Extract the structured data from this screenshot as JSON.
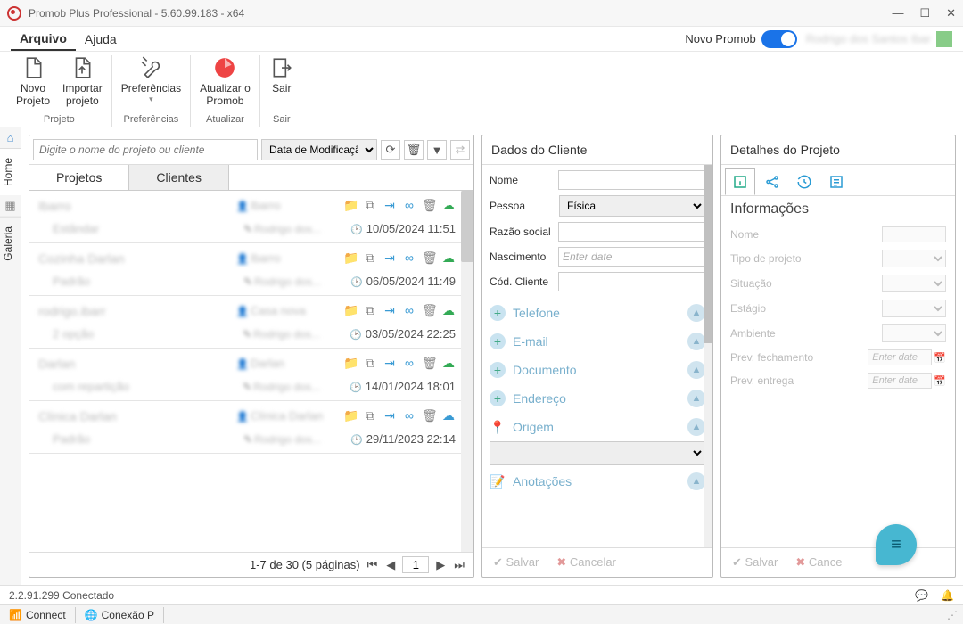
{
  "window": {
    "title": "Promob Plus Professional - 5.60.99.183 - x64"
  },
  "menu": {
    "arquivo": "Arquivo",
    "ajuda": "Ajuda",
    "novo_promob": "Novo Promob",
    "user": "Rodrigo dos Santos Ibar"
  },
  "ribbon": {
    "novo_projeto": "Novo\nProjeto",
    "importar_projeto": "Importar\nprojeto",
    "preferencias": "Preferências",
    "atualizar": "Atualizar o\nPromob",
    "sair": "Sair",
    "group_projeto": "Projeto",
    "group_preferencias": "Preferências",
    "group_atualizar": "Atualizar",
    "group_sair": "Sair"
  },
  "sidetabs": {
    "home": "Home",
    "galeria": "Galeria"
  },
  "left": {
    "search_placeholder": "Digite o nome do projeto ou cliente",
    "sort": "Data de Modificação",
    "tab_projetos": "Projetos",
    "tab_clientes": "Clientes",
    "projects": [
      {
        "name": "Ibarro",
        "client": "Ibarro",
        "variant": "Estândar",
        "author": "Rodrigo dos...",
        "date": "10/05/2024 11:51"
      },
      {
        "name": "Cozinha Darlan",
        "client": "Ibarro",
        "variant": "Padrão",
        "author": "Rodrigo dos...",
        "date": "06/05/2024 11:49"
      },
      {
        "name": "rodrigo.ibarr",
        "client": "Casa nova",
        "variant": "2 opção",
        "author": "Rodrigo dos...",
        "date": "03/05/2024 22:25"
      },
      {
        "name": "Darlan",
        "client": "Darlan",
        "variant": "com repartição",
        "author": "Rodrigo dos...",
        "date": "14/01/2024 18:01"
      },
      {
        "name": "Clínica Darlan",
        "client": "Clínica Darlan",
        "variant": "Padrão",
        "author": "Rodrigo dos...",
        "date": "29/11/2023 22:14"
      }
    ],
    "pager": {
      "label": "1-7 de 30 (5 páginas)",
      "page": "1"
    }
  },
  "mid": {
    "title": "Dados do Cliente",
    "labels": {
      "nome": "Nome",
      "pessoa": "Pessoa",
      "razao": "Razão social",
      "nascimento": "Nascimento",
      "cod": "Cód. Cliente"
    },
    "pessoa_value": "Física",
    "nascimento_placeholder": "Enter date",
    "sections": {
      "telefone": "Telefone",
      "email": "E-mail",
      "documento": "Documento",
      "endereco": "Endereço",
      "origem": "Origem",
      "anotacoes": "Anotações"
    },
    "salvar": "Salvar",
    "cancelar": "Cancelar"
  },
  "right": {
    "title": "Detalhes do Projeto",
    "info_title": "Informações",
    "labels": {
      "nome": "Nome",
      "tipo": "Tipo de projeto",
      "situacao": "Situação",
      "estagio": "Estágio",
      "ambiente": "Ambiente",
      "prev_fech": "Prev. fechamento",
      "prev_entr": "Prev. entrega"
    },
    "date_placeholder": "Enter date",
    "salvar": "Salvar",
    "cancelar": "Cance"
  },
  "status": {
    "version": "2.2.91.299",
    "conn": "Conectado",
    "tab_connect": "Connect",
    "tab_conexao": "Conexão P"
  }
}
